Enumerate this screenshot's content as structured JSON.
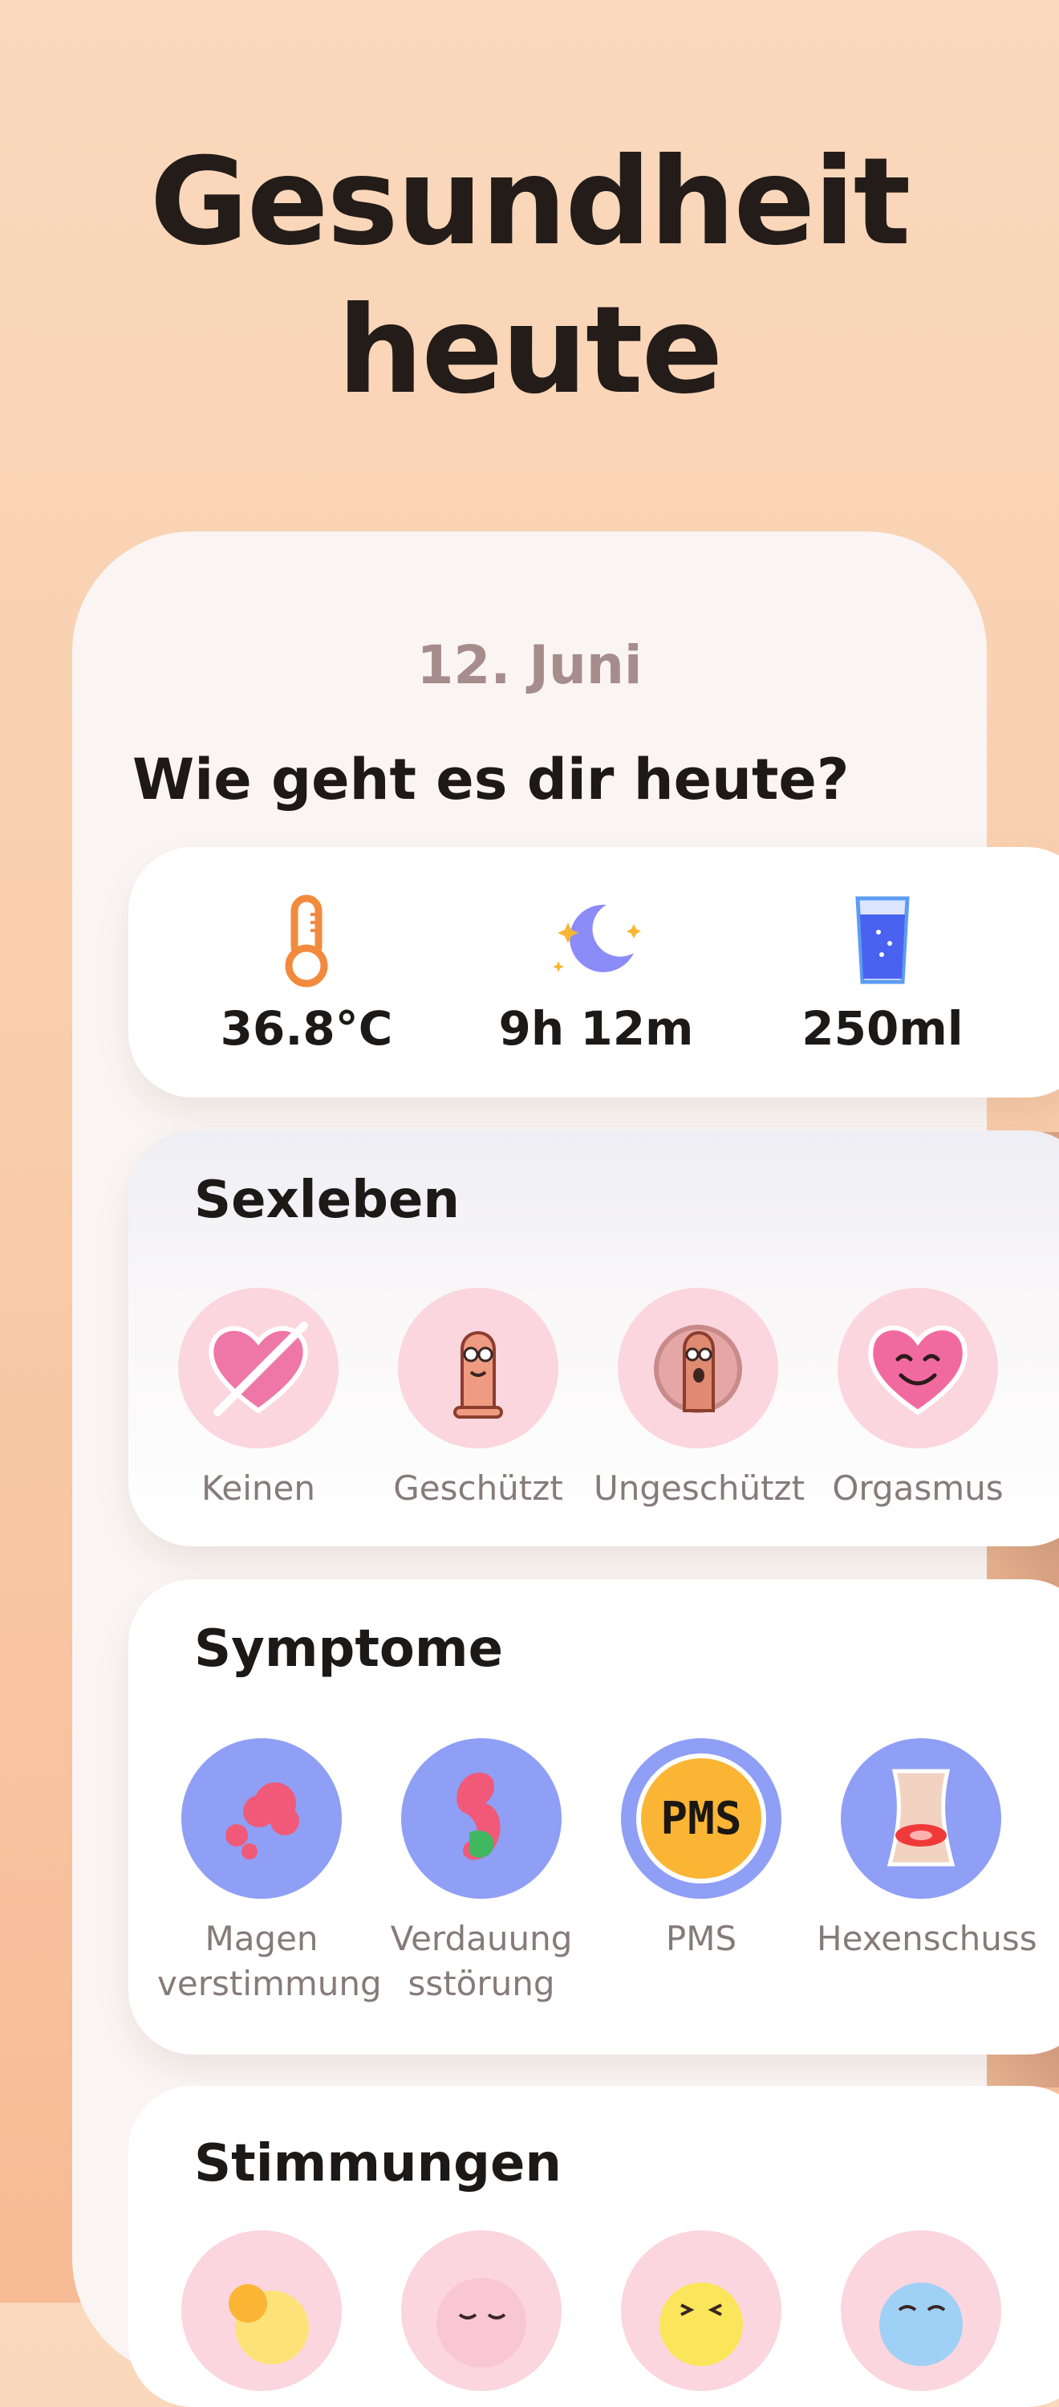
{
  "hero": {
    "line1": "Gesundheit",
    "line2": "heute"
  },
  "card": {
    "date": "12. Juni",
    "question": "Wie geht es dir heute?"
  },
  "metrics": [
    {
      "icon": "thermometer-icon",
      "value": "36.8°C"
    },
    {
      "icon": "moon-icon",
      "value": "9h 12m"
    },
    {
      "icon": "water-glass-icon",
      "value": "250ml"
    }
  ],
  "sexleben": {
    "title": "Sexleben",
    "options": [
      {
        "icon": "crossed-heart-icon",
        "label": "Keinen"
      },
      {
        "icon": "condom-icon",
        "label": "Geschützt"
      },
      {
        "icon": "no-condom-icon",
        "label": "Ungeschützt"
      },
      {
        "icon": "smiling-heart-icon",
        "label": "Orgasmus"
      }
    ]
  },
  "symptome": {
    "title": "Symptome",
    "options": [
      {
        "icon": "upset-stomach-icon",
        "label_line1": "Magen",
        "label_line2": "verstimmung"
      },
      {
        "icon": "digestion-icon",
        "label_line1": "Verdauung",
        "label_line2": "sstörung"
      },
      {
        "icon": "pms-icon",
        "label_line1": "PMS",
        "label_line2": ""
      },
      {
        "icon": "back-pain-icon",
        "label_line1": "Hexenschuss",
        "label_line2": ""
      }
    ]
  },
  "stimmungen": {
    "title": "Stimmungen",
    "options": [
      {
        "icon": "sunny-mood-icon"
      },
      {
        "icon": "calm-mood-icon"
      },
      {
        "icon": "laughing-mood-icon"
      },
      {
        "icon": "sad-mood-icon"
      }
    ]
  },
  "colors": {
    "background": "#fad9bd",
    "card": "#faf5f3",
    "date": "#a68d8b",
    "pink_circle": "#fbd6df",
    "blue_circle": "#8f9ff5"
  }
}
